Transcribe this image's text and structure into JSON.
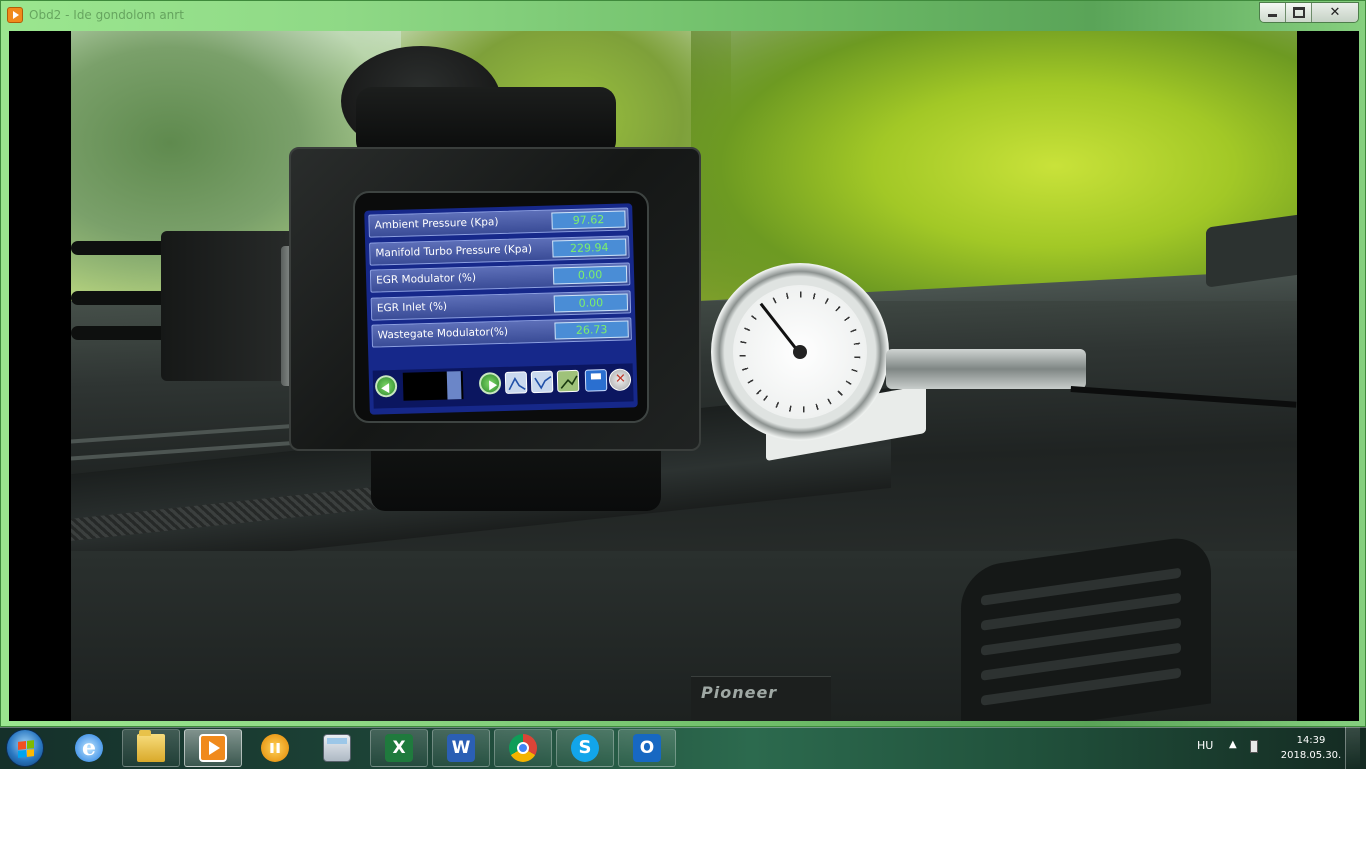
{
  "window": {
    "title": "Obd2 - Ide gondolom anrt",
    "controls": {
      "minimize": "minimize",
      "maximize": "maximize",
      "close": "close"
    }
  },
  "video": {
    "brand_label": "Pioneer",
    "obd_screen": {
      "parameters": [
        {
          "label": "Ambient Pressure (Kpa)",
          "value": "97.62"
        },
        {
          "label": "Manifold Turbo Pressure (Kpa)",
          "value": "229.94"
        },
        {
          "label": "EGR Modulator (%)",
          "value": "0.00"
        },
        {
          "label": "EGR Inlet (%)",
          "value": "0.00"
        },
        {
          "label": "Wastegate Modulator(%)",
          "value": "26.73"
        }
      ],
      "toolbar_icons": [
        "back-arrow-icon",
        "next-arrow-icon",
        "graph-peak-icon",
        "graph-valley-icon",
        "graph-rise-icon",
        "save-icon",
        "close-icon"
      ]
    }
  },
  "taskbar": {
    "apps": [
      {
        "name": "internet-explorer",
        "glyph": "e"
      },
      {
        "name": "file-explorer",
        "glyph": ""
      },
      {
        "name": "media-player",
        "glyph": ""
      },
      {
        "name": "people-app",
        "glyph": "ıı"
      },
      {
        "name": "calculator",
        "glyph": ""
      },
      {
        "name": "excel",
        "glyph": "X"
      },
      {
        "name": "word",
        "glyph": "W"
      },
      {
        "name": "chrome",
        "glyph": ""
      },
      {
        "name": "skype",
        "glyph": "S"
      },
      {
        "name": "outlook",
        "glyph": "O"
      }
    ],
    "tray": {
      "language": "HU",
      "time": "14:39",
      "date": "2018.05.30."
    }
  },
  "colors": {
    "window_frame": "#8fd986",
    "obd_screen_bg": "#16288a",
    "obd_value_text": "#7df06a",
    "taskbar": "#1d4437"
  }
}
